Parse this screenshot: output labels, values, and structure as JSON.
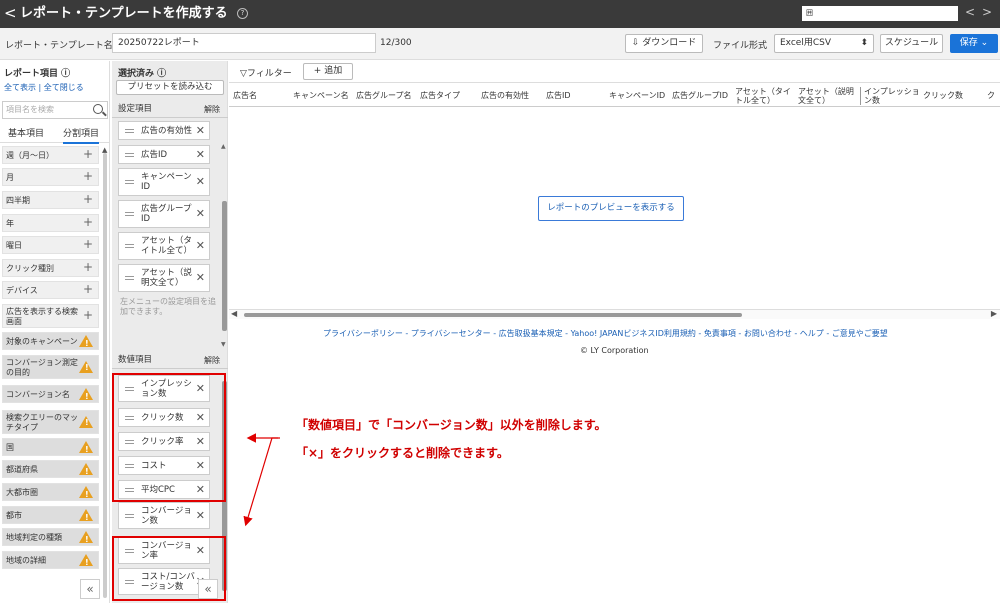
{
  "topbar": {
    "back": "<",
    "title": "レポート・テンプレートを作成する",
    "help": "?",
    "account": "囲",
    "nav_prev": "<",
    "nav_next": ">"
  },
  "namebar": {
    "label": "レポート・テンプレート名",
    "value": "20250722レポート",
    "count": "12/300",
    "download": "⇩ ダウンロード",
    "format_label": "ファイル形式",
    "format_value": "Excel用CSV",
    "schedule": "スケジュール",
    "save": "保存 ⌄"
  },
  "left": {
    "title": "レポート項目 ⓘ",
    "links": "全て表示 | 全て閉じる",
    "search_placeholder": "項目名を検索",
    "tabs": [
      "基本項目",
      "分割項目"
    ],
    "items": [
      {
        "label": "週（月〜日）",
        "kind": "plus"
      },
      {
        "label": "月",
        "kind": "plus"
      },
      {
        "label": "四半期",
        "kind": "plus"
      },
      {
        "label": "年",
        "kind": "plus"
      },
      {
        "label": "曜日",
        "kind": "plus"
      },
      {
        "label": "クリック種別",
        "kind": "plus"
      },
      {
        "label": "デバイス",
        "kind": "plus"
      },
      {
        "label": "広告を表示する検索画面",
        "kind": "plus"
      },
      {
        "label": "対象のキャンペーン",
        "kind": "warn"
      },
      {
        "label": "コンバージョン測定の目的",
        "kind": "warn"
      },
      {
        "label": "コンバージョン名",
        "kind": "warn"
      },
      {
        "label": "検索クエリーのマッチタイプ",
        "kind": "warn"
      },
      {
        "label": "国",
        "kind": "warn"
      },
      {
        "label": "都道府県",
        "kind": "warn"
      },
      {
        "label": "大都市圏",
        "kind": "warn"
      },
      {
        "label": "都市",
        "kind": "warn"
      },
      {
        "label": "地域判定の種類",
        "kind": "warn"
      },
      {
        "label": "地域の詳細",
        "kind": "warn"
      }
    ],
    "collapse": "«"
  },
  "middle": {
    "title": "選択済み ⓘ",
    "preset": "プリセットを読み込む",
    "settings_label": "設定項目",
    "clear": "解除",
    "settings_items": [
      "広告の有効性",
      "広告ID",
      "キャンペーンID",
      "広告グループID",
      "アセット（タイトル全て）",
      "アセット（説明文全て）"
    ],
    "note": "左メニューの設定項目を追加できます。",
    "metrics_label": "数値項目",
    "metrics_items": [
      "インプレッション数",
      "クリック数",
      "クリック率",
      "コスト",
      "平均CPC",
      "コンバージョン数",
      "コンバージョン率",
      "コスト/コンバージョン数"
    ],
    "collapse": "«",
    "x": "✕",
    "up": "▲",
    "down": "▼"
  },
  "main": {
    "filter": "▽フィルター",
    "add": "+ 追加",
    "columns": [
      "広告名",
      "キャンペーン名",
      "広告グループ名",
      "広告タイプ",
      "広告の有効性",
      "広告ID",
      "キャンペーンID",
      "広告グループID",
      "アセット（タイトル全て）",
      "アセット（説明文全て）",
      "インプレッション数",
      "クリック数",
      "ク"
    ],
    "preview_button": "レポートのプレビューを表示する",
    "footer_links": "プライバシーポリシー - プライバシーセンター - 広告取扱基本規定 - Yahoo! JAPANビジネスID利用規約 - 免責事項 - お問い合わせ - ヘルプ - ご意見やご要望",
    "copyright": "© LY Corporation",
    "scroll_left": "◀",
    "scroll_right": "▶"
  },
  "annotation": {
    "line1": "「数値項目」で「コンバージョン数」以外を削除します。",
    "line2": "「×」をクリックすると削除できます。",
    "color": "#e00000"
  }
}
